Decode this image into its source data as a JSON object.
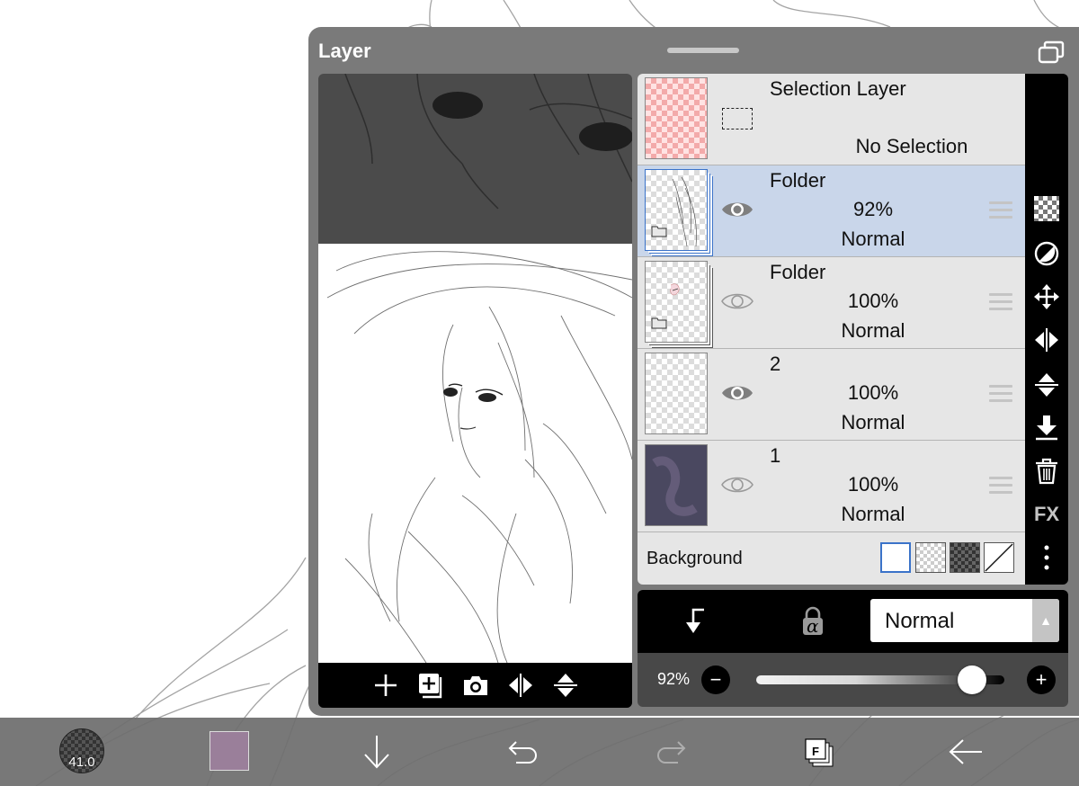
{
  "panel": {
    "title": "Layer"
  },
  "layers": [
    {
      "name": "Selection Layer",
      "state": "No Selection",
      "type": "selection"
    },
    {
      "name": "Folder",
      "opacity": "92%",
      "blend": "Normal",
      "type": "folder",
      "visible": true,
      "selected": true
    },
    {
      "name": "Folder",
      "opacity": "100%",
      "blend": "Normal",
      "type": "folder",
      "visible": false,
      "selected": false
    },
    {
      "name": "2",
      "opacity": "100%",
      "blend": "Normal",
      "type": "layer",
      "visible": true,
      "selected": false
    },
    {
      "name": "1",
      "opacity": "100%",
      "blend": "Normal",
      "type": "layer",
      "visible": false,
      "selected": false
    }
  ],
  "background": {
    "label": "Background",
    "options": [
      "white",
      "transparent",
      "dark-checker",
      "none"
    ],
    "selected": "white"
  },
  "side_tools": {
    "fx_label": "FX",
    "icons": [
      "checker-icon",
      "circle-half-icon",
      "move-icon",
      "flip-horizontal-icon",
      "flip-vertical-icon",
      "merge-down-icon",
      "trash-icon",
      "fx-icon",
      "more-icon"
    ]
  },
  "blend_bar": {
    "mode": "Normal",
    "alpha_glyph": "α"
  },
  "opacity_bar": {
    "value_label": "92%",
    "value": 0.92,
    "minus": "−",
    "plus": "+"
  },
  "bottom_bar": {
    "brush_size": "41.0",
    "layers_label": "F",
    "current_color": "#9a7f9a"
  },
  "colors": {
    "panel_bg": "#7a7a7a",
    "selected_row": "#c9d6ea",
    "accent": "#3b73c9"
  }
}
